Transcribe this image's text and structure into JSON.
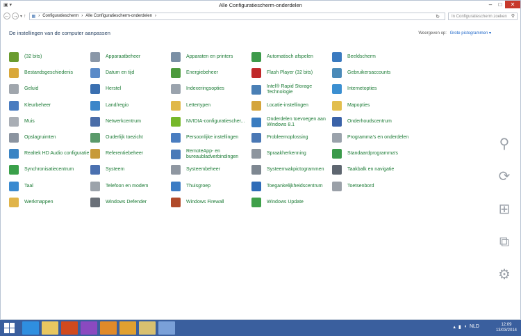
{
  "window": {
    "title": "Alle Configuratiescherm-onderdelen",
    "breadcrumb": [
      "Configuratiescherm",
      "Alle Configuratiescherm-onderdelen"
    ],
    "search_placeholder": "In Configuratiescherm zoeken"
  },
  "header": {
    "title": "De instellingen van de computer aanpassen",
    "view_by_label": "Weergeven op:",
    "view_by_value": "Grote pictogrammen"
  },
  "items": [
    {
      "label": "(32 bits)",
      "color": "#6a9b2e"
    },
    {
      "label": "Apparaatbeheer",
      "color": "#8a97a8"
    },
    {
      "label": "Apparaten en printers",
      "color": "#7a8fa5"
    },
    {
      "label": "Automatisch afspelen",
      "color": "#3d9a4a"
    },
    {
      "label": "Beeldscherm",
      "color": "#3a7ac0"
    },
    {
      "label": "Bestandsgeschiedenis",
      "color": "#d9a83a"
    },
    {
      "label": "Datum en tijd",
      "color": "#5a8ac8"
    },
    {
      "label": "Energiebeheer",
      "color": "#4c9a3c"
    },
    {
      "label": "Flash Player (32 bits)",
      "color": "#c0282a"
    },
    {
      "label": "Gebruikersaccounts",
      "color": "#4a8ab8"
    },
    {
      "label": "Geluid",
      "color": "#a0a6ad"
    },
    {
      "label": "Herstel",
      "color": "#3a6fb0"
    },
    {
      "label": "Indexeringsopties",
      "color": "#9aa3ad"
    },
    {
      "label": "Intel® Rapid Storage Technologie",
      "color": "#4a7fb5"
    },
    {
      "label": "Internetopties",
      "color": "#3b8fd1"
    },
    {
      "label": "Kleurbeheer",
      "color": "#4a7cc0"
    },
    {
      "label": "Land/regio",
      "color": "#3c86c9"
    },
    {
      "label": "Lettertypen",
      "color": "#e0b84a"
    },
    {
      "label": "Locatie-instellingen",
      "color": "#d4a53c"
    },
    {
      "label": "Mapopties",
      "color": "#e2be4e"
    },
    {
      "label": "Muis",
      "color": "#a9aeb5"
    },
    {
      "label": "Netwerkcentrum",
      "color": "#4a6da8"
    },
    {
      "label": "NVIDIA-configuratiescher...",
      "color": "#76b82a"
    },
    {
      "label": "Onderdelen toevoegen aan Windows 8.1",
      "color": "#3a7cc0"
    },
    {
      "label": "Onderhoudscentrum",
      "color": "#3a62a8"
    },
    {
      "label": "Opslagruimten",
      "color": "#8b94a0"
    },
    {
      "label": "Ouderlijk toezicht",
      "color": "#5a9a6a"
    },
    {
      "label": "Persoonlijke instellingen",
      "color": "#4a7dc0"
    },
    {
      "label": "Probleemoplossing",
      "color": "#4a78b5"
    },
    {
      "label": "Programma's en onderdelen",
      "color": "#9aa2ab"
    },
    {
      "label": "Realtek HD Audio configuratie",
      "color": "#3a84c4"
    },
    {
      "label": "Referentiebeheer",
      "color": "#c79a3a"
    },
    {
      "label": "RemoteApp- en bureaubladverbindingen",
      "color": "#4a7ab8"
    },
    {
      "label": "Spraakherkenning",
      "color": "#8d959e"
    },
    {
      "label": "Standaardprogramma's",
      "color": "#3a9a4a"
    },
    {
      "label": "Synchronisatiecentrum",
      "color": "#3aa04a"
    },
    {
      "label": "Systeem",
      "color": "#4a70b0"
    },
    {
      "label": "Systeembeheer",
      "color": "#8f97a1"
    },
    {
      "label": "Systeemvakpictogrammen",
      "color": "#7e8791"
    },
    {
      "label": "Taakbalk en navigatie",
      "color": "#5e6670"
    },
    {
      "label": "Taal",
      "color": "#3a8ad0"
    },
    {
      "label": "Telefoon en modem",
      "color": "#9ca3ab"
    },
    {
      "label": "Thuisgroep",
      "color": "#3c7cc4"
    },
    {
      "label": "Toegankelijkheidscentrum",
      "color": "#2f6cb8"
    },
    {
      "label": "Toetsenbord",
      "color": "#9aa0a8"
    },
    {
      "label": "Werkmappen",
      "color": "#e0b44a"
    },
    {
      "label": "Windows Defender",
      "color": "#6a7078"
    },
    {
      "label": "Windows Firewall",
      "color": "#b04a2a"
    },
    {
      "label": "Windows Update",
      "color": "#3fa04a"
    }
  ],
  "charms": [
    {
      "name": "search-charm-icon",
      "glyph": "⚲"
    },
    {
      "name": "share-charm-icon",
      "glyph": "⟳"
    },
    {
      "name": "start-charm-icon",
      "glyph": "⊞"
    },
    {
      "name": "devices-charm-icon",
      "glyph": "⧉"
    },
    {
      "name": "settings-charm-icon",
      "glyph": "⚙"
    }
  ],
  "taskbar": {
    "background": "#3a5f9e",
    "apps": [
      {
        "name": "internet-explorer-icon",
        "color": "#2f8fe0"
      },
      {
        "name": "file-explorer-icon",
        "color": "#e8c760"
      },
      {
        "name": "office-icon",
        "color": "#d04a1e"
      },
      {
        "name": "photo-app-icon",
        "color": "#8a4ac0"
      },
      {
        "name": "media-player-icon",
        "color": "#e08a2a"
      },
      {
        "name": "chrome-icon",
        "color": "#e0a030"
      },
      {
        "name": "folder-icon",
        "color": "#d8c070"
      },
      {
        "name": "control-panel-icon",
        "color": "#7aa0d8"
      }
    ],
    "language": "NLD",
    "time": "12:09",
    "date": "13/03/2014"
  }
}
